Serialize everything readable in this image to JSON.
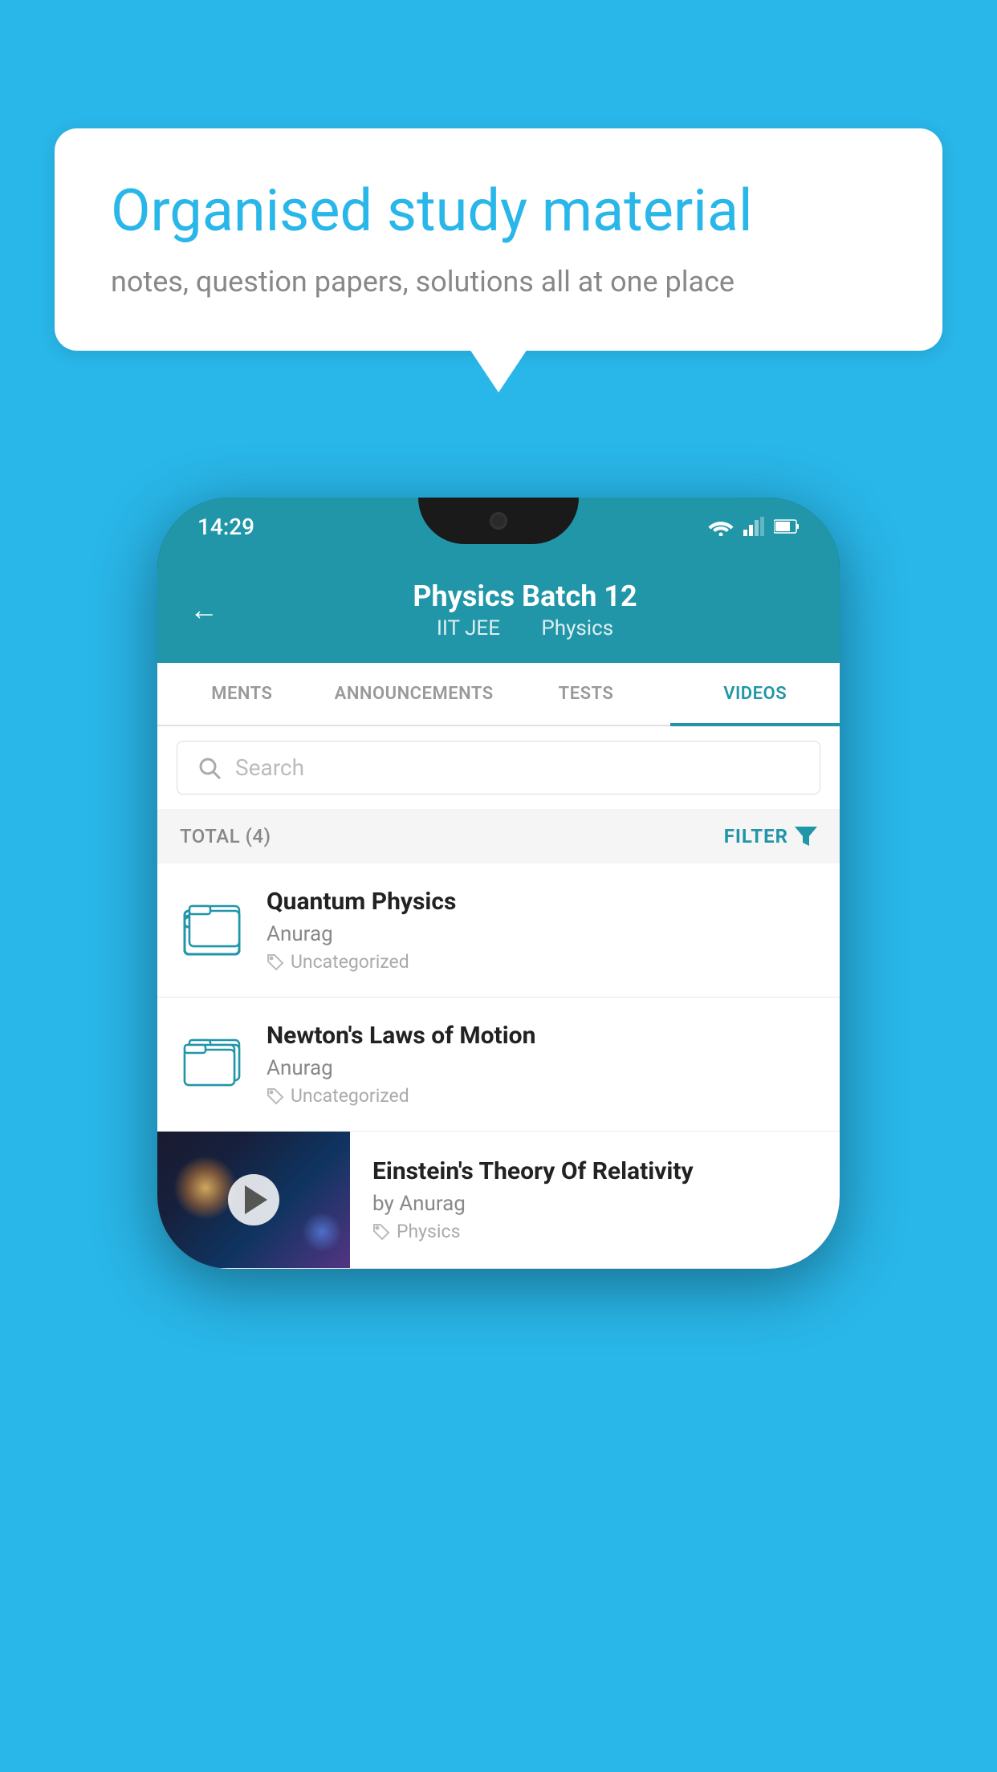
{
  "background_color": "#29b6e8",
  "bubble": {
    "title": "Organised study material",
    "subtitle": "notes, question papers, solutions all at one place"
  },
  "phone": {
    "status_bar": {
      "time": "14:29"
    },
    "header": {
      "title": "Physics Batch 12",
      "subtitle_part1": "IIT JEE",
      "subtitle_part2": "Physics",
      "back_label": "←"
    },
    "tabs": [
      {
        "label": "MENTS",
        "active": false
      },
      {
        "label": "ANNOUNCEMENTS",
        "active": false
      },
      {
        "label": "TESTS",
        "active": false
      },
      {
        "label": "VIDEOS",
        "active": true
      }
    ],
    "search": {
      "placeholder": "Search"
    },
    "filter_bar": {
      "total_label": "TOTAL (4)",
      "filter_label": "FILTER"
    },
    "videos": [
      {
        "id": 1,
        "title": "Quantum Physics",
        "author": "Anurag",
        "tag": "Uncategorized",
        "has_thumbnail": false
      },
      {
        "id": 2,
        "title": "Newton's Laws of Motion",
        "author": "Anurag",
        "tag": "Uncategorized",
        "has_thumbnail": false
      },
      {
        "id": 3,
        "title": "Einstein's Theory Of Relativity",
        "author": "by Anurag",
        "tag": "Physics",
        "has_thumbnail": true
      }
    ]
  }
}
